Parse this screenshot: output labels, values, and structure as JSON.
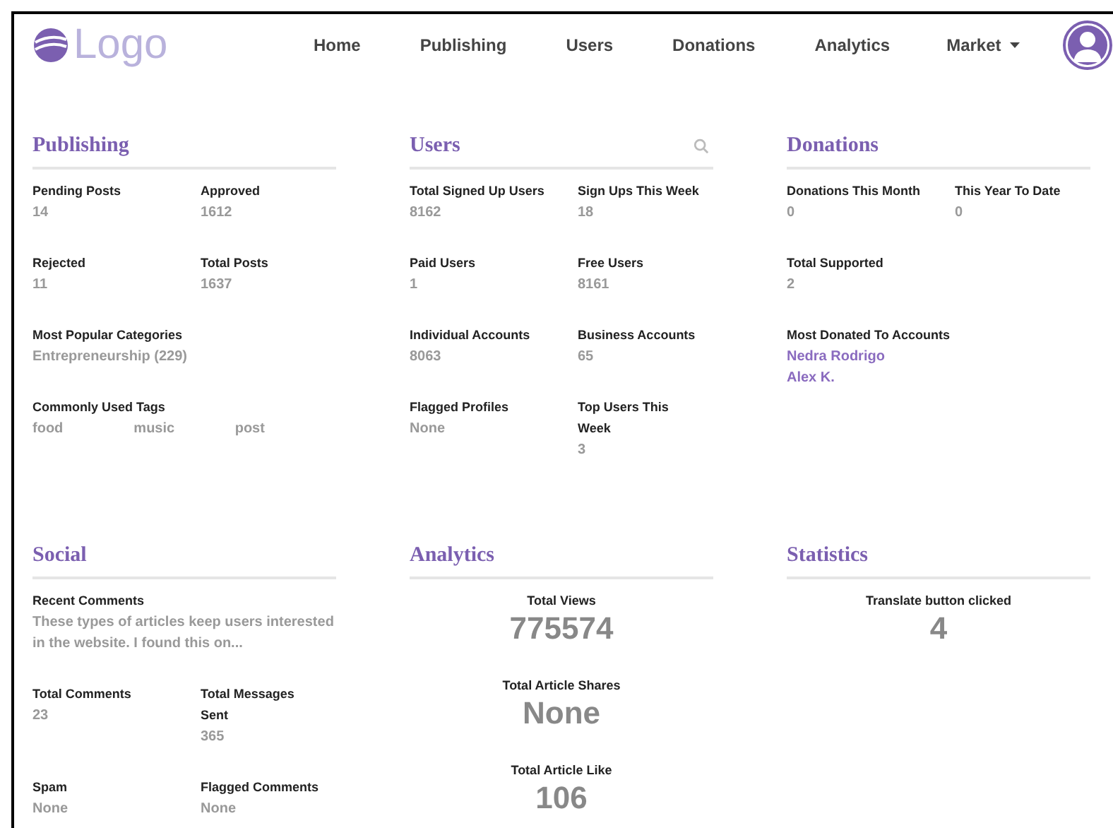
{
  "nav": {
    "logo": "Logo",
    "links": [
      {
        "label": "Home"
      },
      {
        "label": "Publishing"
      },
      {
        "label": "Users"
      },
      {
        "label": "Donations"
      },
      {
        "label": "Analytics"
      }
    ],
    "dropdown": {
      "label": "Market"
    }
  },
  "sections": [
    {
      "title": "Publishing",
      "search": false,
      "fields": [
        {
          "kind": "pair",
          "label": "Pending Posts",
          "value": "14"
        },
        {
          "kind": "pair",
          "label": "Approved",
          "value": "1612"
        },
        {
          "kind": "pair",
          "label": "Rejected",
          "value": "11"
        },
        {
          "kind": "pair",
          "label": "Total Posts",
          "value": "1637"
        },
        {
          "kind": "full",
          "label": "Most Popular Categories",
          "value": "Entrepreneurship (229)"
        },
        {
          "kind": "tags",
          "label": "Commonly Used Tags",
          "values": [
            "food",
            "music",
            "post"
          ]
        }
      ]
    },
    {
      "title": "Users",
      "search": true,
      "fields": [
        {
          "kind": "pair",
          "label": "Total Signed Up Users",
          "value": "8162"
        },
        {
          "kind": "pair",
          "label": "Sign Ups This Week",
          "value": "18"
        },
        {
          "kind": "pair",
          "label": "Paid Users",
          "value": "1"
        },
        {
          "kind": "pair",
          "label": "Free Users",
          "value": "8161"
        },
        {
          "kind": "pair",
          "label": "Individual Accounts",
          "value": "8063"
        },
        {
          "kind": "pair",
          "label": "Business Accounts",
          "value": "65"
        },
        {
          "kind": "pair",
          "label": "Flagged Profiles",
          "value": "None"
        },
        {
          "kind": "pair",
          "label": "Top Users This Week",
          "value": "3"
        }
      ]
    },
    {
      "title": "Donations",
      "search": false,
      "fields": [
        {
          "kind": "pair",
          "label": "Donations This Month",
          "value": "0"
        },
        {
          "kind": "pair",
          "label": "This Year To Date",
          "value": "0"
        },
        {
          "kind": "full",
          "label": "Total Supported",
          "value": "2"
        },
        {
          "kind": "links",
          "label": "Most Donated To Accounts",
          "values": [
            "Nedra Rodrigo",
            "Alex K."
          ]
        }
      ]
    },
    {
      "title": "Social",
      "search": false,
      "fields": [
        {
          "kind": "full",
          "label": "Recent Comments",
          "value": "These types of articles keep users interested in the website. I found this on..."
        },
        {
          "kind": "pair",
          "label": "Total Comments",
          "value": "23"
        },
        {
          "kind": "pair",
          "label": "Total Messages Sent",
          "value": "365"
        },
        {
          "kind": "pair",
          "label": "Spam",
          "value": "None"
        },
        {
          "kind": "pair",
          "label": "Flagged Comments",
          "value": "None"
        }
      ]
    },
    {
      "title": "Analytics",
      "search": false,
      "fields": [
        {
          "kind": "big",
          "label": "Total Views",
          "value": "775574"
        },
        {
          "kind": "big",
          "label": "Total Article Shares",
          "value": "None"
        },
        {
          "kind": "big",
          "label": "Total Article Like",
          "value": "106"
        }
      ]
    },
    {
      "title": "Statistics",
      "search": false,
      "fields": [
        {
          "kind": "big",
          "label": "Translate button clicked",
          "value": "4"
        }
      ]
    }
  ]
}
